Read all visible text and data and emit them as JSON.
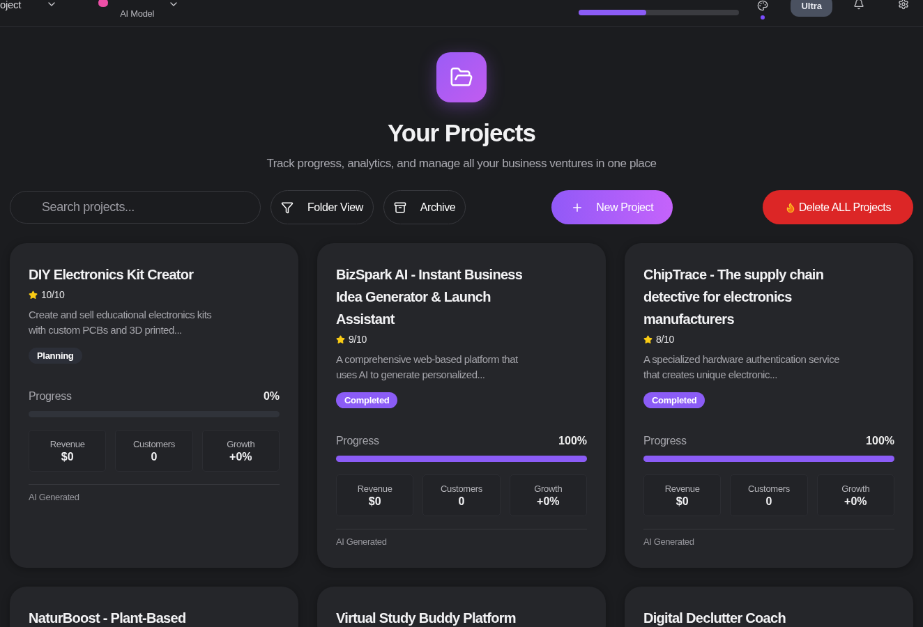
{
  "top_bar": {
    "project_label": "oject",
    "model_label": "AI Model",
    "usage": {
      "level": 0.42
    },
    "plan_badge": "Ultra"
  },
  "header": {
    "title": "Your Projects",
    "subtitle": "Track progress, analytics, and manage all your business ventures in one place"
  },
  "toolbar": {
    "search": {
      "placeholder": "Search projects..."
    },
    "buttons": [
      {
        "label": "Folder View",
        "kind": "folder"
      },
      {
        "label": "Archive",
        "kind": "archive"
      },
      {
        "label": "New Project",
        "kind": "new"
      },
      {
        "label": "Delete ALL Projects",
        "kind": "delete"
      }
    ]
  },
  "projects": [
    {
      "title": "DIY Electronics Kit Creator",
      "rating": "10/10",
      "description": "Create and sell educational electronics kits with custom PCBs and 3D printed...",
      "status": {
        "label": "Planning",
        "kind": "planning"
      },
      "progress_label": "Progress",
      "progress_value": "0%",
      "level": 0,
      "stats": [
        {
          "label": "Revenue",
          "value": "$0"
        },
        {
          "label": "Customers",
          "value": "0"
        },
        {
          "label": "Growth",
          "value": "+0%"
        }
      ],
      "footer": "AI Generated"
    },
    {
      "title": "BizSpark AI - Instant Business Idea Generator & Launch Assistant",
      "rating": "9/10",
      "description": "A comprehensive web-based platform that uses AI to generate personalized...",
      "status": {
        "label": "Completed",
        "kind": "completed"
      },
      "progress_label": "Progress",
      "progress_value": "100%",
      "level": 1,
      "stats": [
        {
          "label": "Revenue",
          "value": "$0"
        },
        {
          "label": "Customers",
          "value": "0"
        },
        {
          "label": "Growth",
          "value": "+0%"
        }
      ],
      "footer": "AI Generated"
    },
    {
      "title": "ChipTrace - The supply chain detective for electronics manufacturers",
      "rating": "8/10",
      "description": "A specialized hardware authentication service that creates unique electronic...",
      "status": {
        "label": "Completed",
        "kind": "completed"
      },
      "progress_label": "Progress",
      "progress_value": "100%",
      "level": 1,
      "stats": [
        {
          "label": "Revenue",
          "value": "$0"
        },
        {
          "label": "Customers",
          "value": "0"
        },
        {
          "label": "Growth",
          "value": "+0%"
        }
      ],
      "footer": "AI Generated"
    },
    {
      "title": "NaturBoost - Plant-Based"
    },
    {
      "title": "Virtual Study Buddy Platform"
    },
    {
      "title": "Digital Declutter Coach"
    }
  ]
}
